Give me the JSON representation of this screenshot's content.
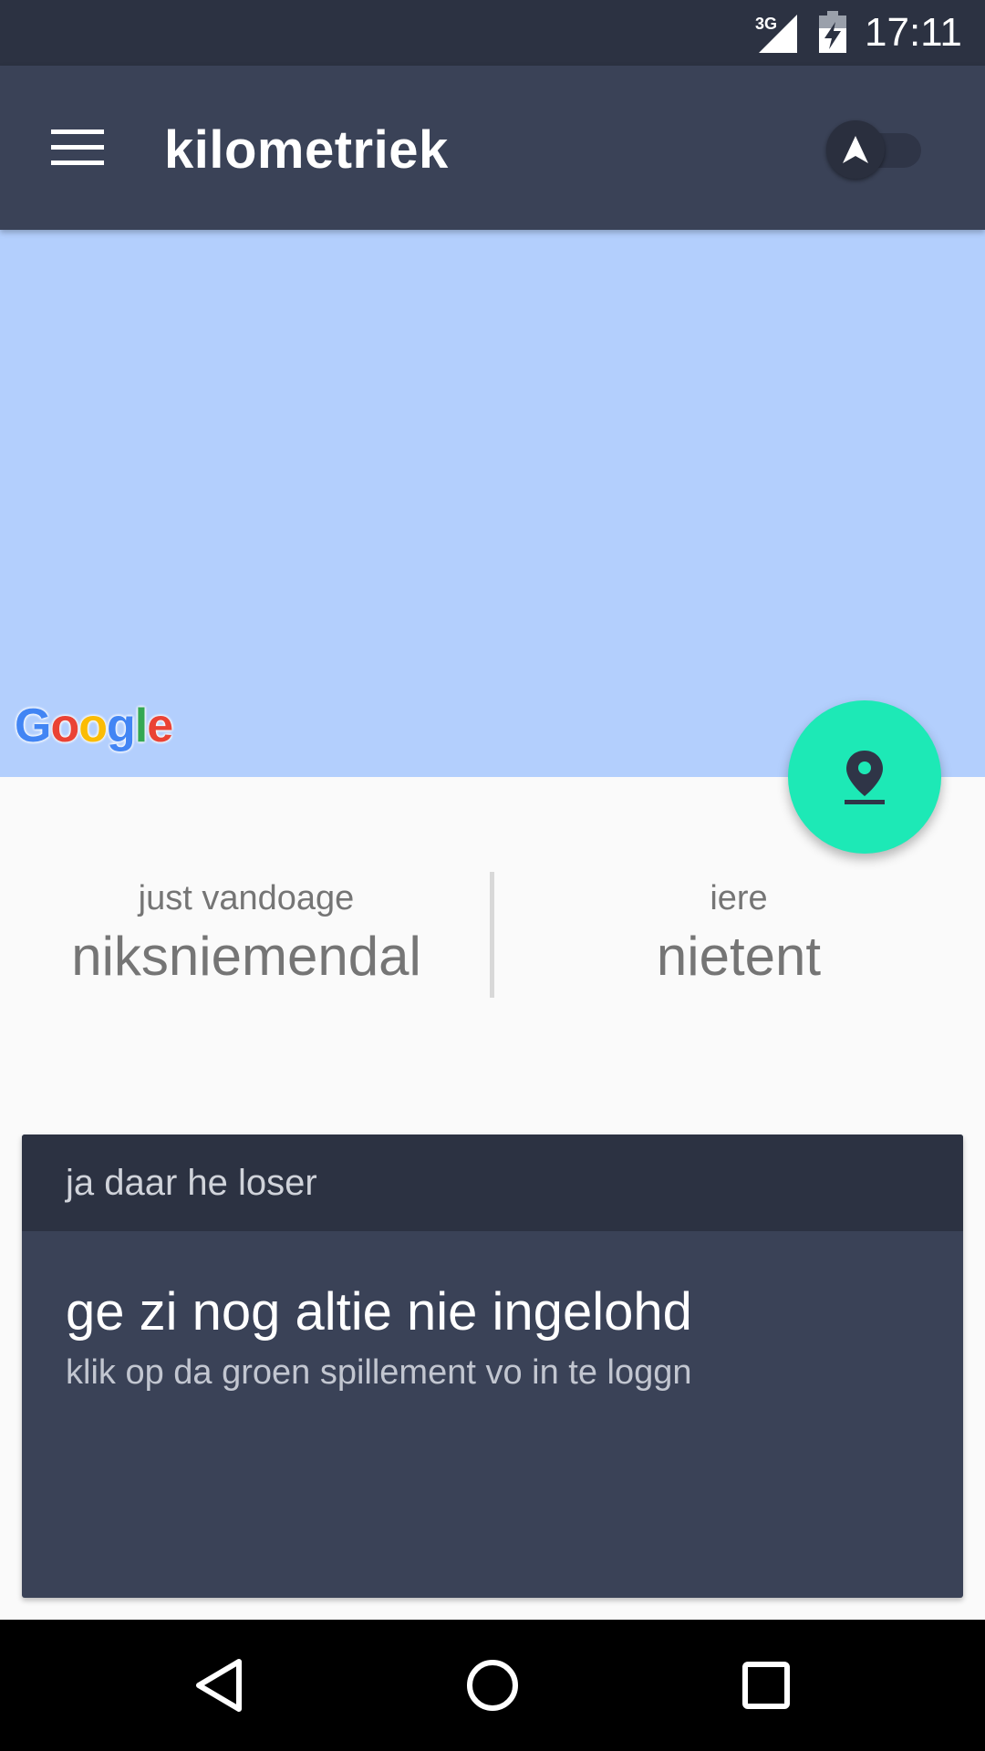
{
  "status_bar": {
    "network": "3G",
    "time": "17:11"
  },
  "toolbar": {
    "title": "kilometriek",
    "menu_icon": "hamburger-menu-icon",
    "navigation_toggle_icon": "navigation-arrow-icon",
    "navigation_toggle_on": false
  },
  "map": {
    "attribution": "Google"
  },
  "fab": {
    "icon": "location-pin-icon",
    "color": "#1de9b6"
  },
  "stats": {
    "today": {
      "label": "just vandoage",
      "value": "niksniemendal"
    },
    "yesterday": {
      "label": "iere",
      "value": "nietent"
    }
  },
  "card": {
    "header": "ja daar he loser",
    "title": "ge zi nog altie nie ingelohd",
    "subtitle": "klik op da groen spillement vo in te loggn"
  },
  "colors": {
    "toolbar": "#3a4257",
    "status_bar": "#2c3242",
    "map_water": "#b3cffd",
    "accent": "#1de9b6"
  }
}
